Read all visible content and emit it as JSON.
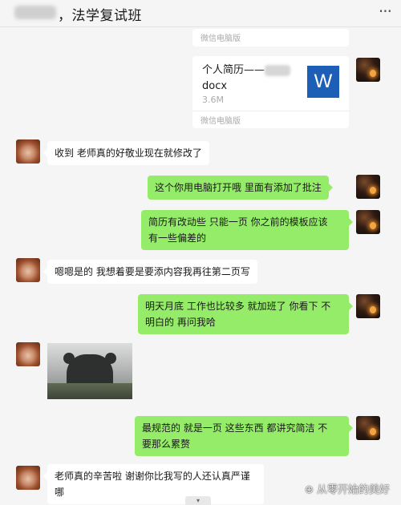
{
  "header": {
    "title": "，法学复试班",
    "more_icon": "more-dots-icon"
  },
  "file_card_top": {
    "footer": "微信电脑版"
  },
  "file_card": {
    "name_prefix": "个人简历——",
    "name_suffix": "docx",
    "size": "3.6M",
    "icon_letter": "W",
    "footer": "微信电脑版"
  },
  "messages": [
    {
      "side": "left",
      "text": "收到 老师真的好敬业现在就修改了"
    },
    {
      "side": "right",
      "text": "这个你用电脑打开哦  里面有添加了批注"
    },
    {
      "side": "right",
      "line1": "简历有改动些   只能一页  你之前的模板应该",
      "line2": "有一些偏差的"
    },
    {
      "side": "left",
      "text": "嗯嗯是的 我想着要是要添内容我再往第二页写"
    },
    {
      "side": "right",
      "line1": "明天月底 工作也比较多 就加班了  你看下  不",
      "line2": "明白的  再问我哈"
    },
    {
      "side": "left",
      "type": "image"
    },
    {
      "side": "right",
      "line1": "最规范的 就是一页  这些东西  都讲究简洁  不",
      "line2": "要那么累赘"
    },
    {
      "side": "left",
      "line1": "老师真的辛苦啦 谢谢你比我写的人还认真严谨",
      "line2": "哪"
    }
  ],
  "watermark": "从零开始的美好",
  "scroll_glyph": "▾"
}
